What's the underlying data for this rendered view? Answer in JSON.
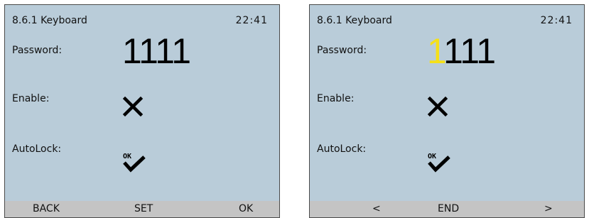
{
  "screens": [
    {
      "title": "8.6.1 Keyboard",
      "clock": "22:41",
      "labels": {
        "password": "Password:",
        "enable": "Enable:",
        "autolock": "AutoLock:"
      },
      "password": {
        "first_digit": "1",
        "rest_digits": "111",
        "editing": false
      },
      "enable_icon": "cross-icon",
      "autolock_icon": "ok-check-icon",
      "autolock_icon_text": "OK",
      "softkeys": [
        "BACK",
        "SET",
        "OK"
      ]
    },
    {
      "title": "8.6.1 Keyboard",
      "clock": "22:41",
      "labels": {
        "password": "Password:",
        "enable": "Enable:",
        "autolock": "AutoLock:"
      },
      "password": {
        "first_digit": "1",
        "rest_digits": "111",
        "editing": true
      },
      "enable_icon": "cross-icon",
      "autolock_icon": "ok-check-icon",
      "autolock_icon_text": "OK",
      "softkeys": [
        "<",
        "END",
        ">"
      ]
    }
  ],
  "colors": {
    "screen_bg": "#b9ccd9",
    "softbar_bg": "#c4c4c4",
    "cursor": "#f5e019"
  }
}
